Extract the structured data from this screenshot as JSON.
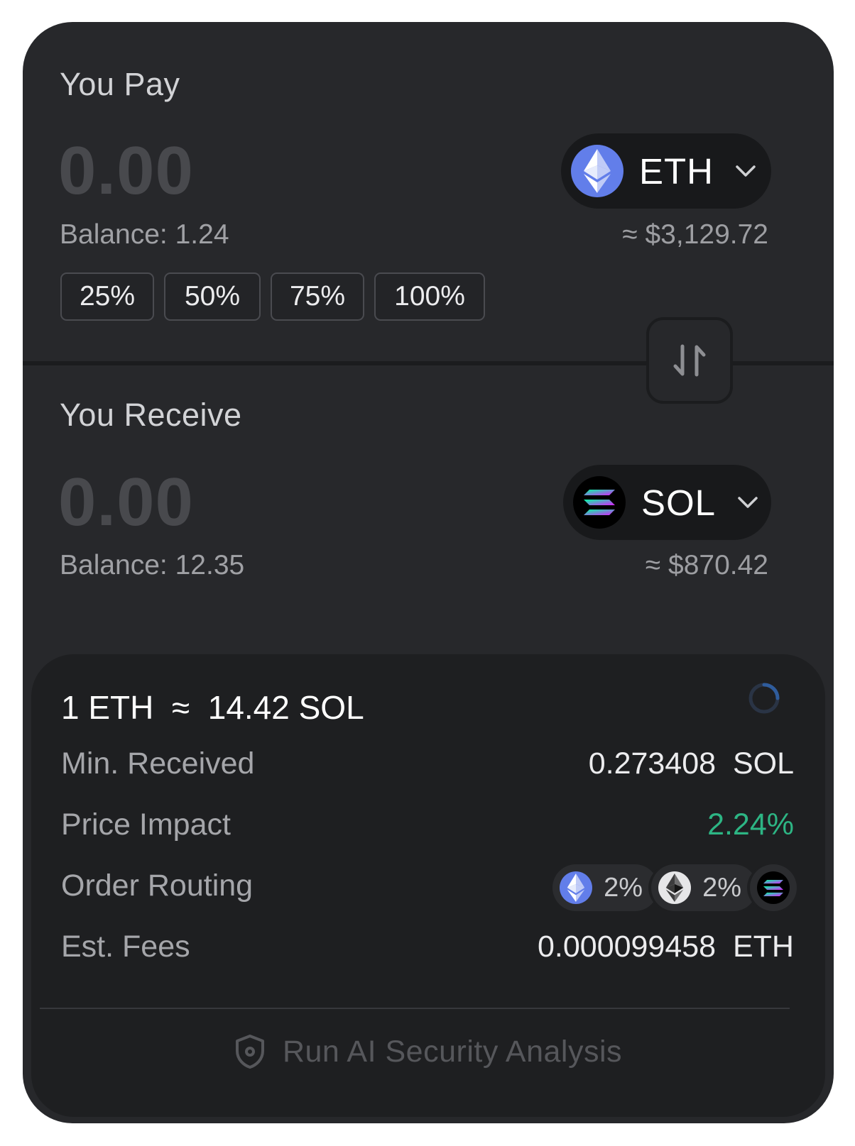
{
  "pay": {
    "label": "You Pay",
    "amount": "0.00",
    "balance": "Balance: 1.24",
    "usd": "≈ $3,129.72",
    "token": {
      "symbol": "ETH",
      "icon": "ethereum-icon",
      "color": "#627eea"
    },
    "percent_buttons": [
      "25%",
      "50%",
      "75%",
      "100%"
    ]
  },
  "receive": {
    "label": "You Receive",
    "amount": "0.00",
    "balance": "Balance: 12.35",
    "usd": "≈ $870.42",
    "token": {
      "symbol": "SOL",
      "icon": "solana-icon",
      "color": "#000000"
    }
  },
  "details": {
    "rate": "1 ETH  ≈  14.42 SOL",
    "min_received": {
      "label": "Min. Received",
      "value": "0.273408  SOL"
    },
    "price_impact": {
      "label": "Price Impact",
      "value": "2.24%",
      "color": "#2db584"
    },
    "order_routing": {
      "label": "Order Routing",
      "hops": [
        {
          "icon": "ethereum-icon",
          "percent": "2%"
        },
        {
          "icon": "ethereum-gray-icon",
          "percent": "2%"
        },
        {
          "icon": "solana-icon"
        }
      ]
    },
    "est_fees": {
      "label": "Est. Fees",
      "value": "0.000099458  ETH"
    }
  },
  "security_button": {
    "label": "Run AI Security Analysis",
    "icon": "shield-icon"
  },
  "colors": {
    "background": "#27282b",
    "panel": "#1e1f21",
    "accent_green": "#2db584"
  }
}
